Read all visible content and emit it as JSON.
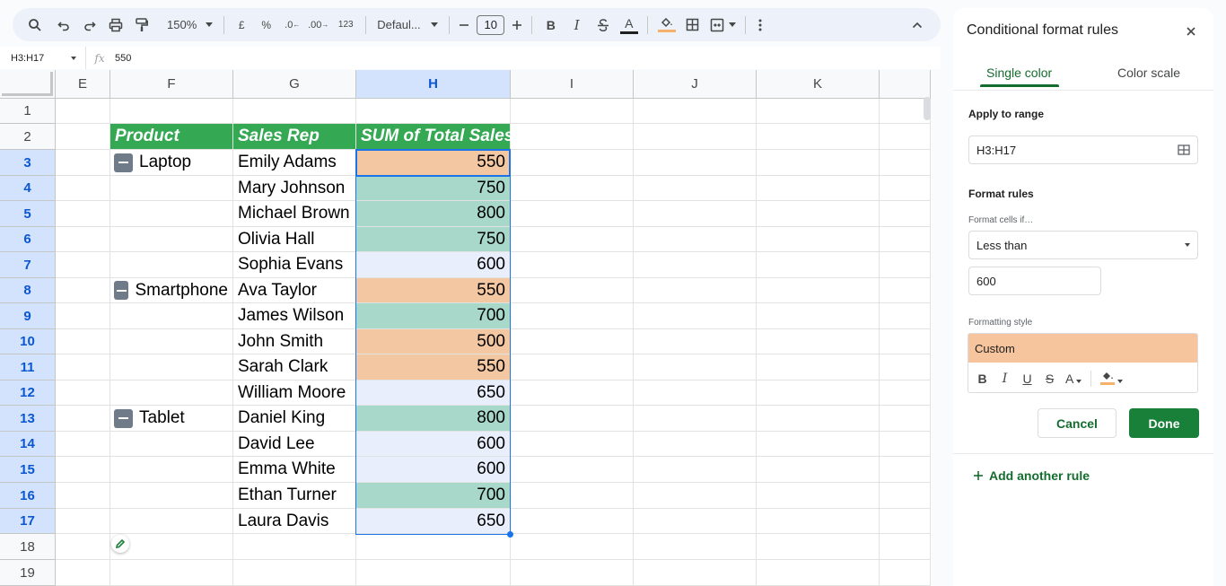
{
  "toolbar": {
    "zoom": "150%",
    "currency": "£",
    "percent": "%",
    "decrease_decimal": ".0",
    "increase_decimal": ".00",
    "number_format": "123",
    "font": "Defaul...",
    "font_size": "10",
    "bold": "B",
    "italic": "I",
    "text_color": "A",
    "text_color_bar": "#1f1f1f",
    "fill_color_bar": "#f6b26b"
  },
  "formula_bar": {
    "name_box": "H3:H17",
    "fx": "fx",
    "value": "550"
  },
  "grid": {
    "columns": [
      "E",
      "F",
      "G",
      "H",
      "I",
      "J",
      "K"
    ],
    "rows": [
      "1",
      "2",
      "3",
      "4",
      "5",
      "6",
      "7",
      "8",
      "9",
      "10",
      "11",
      "12",
      "13",
      "14",
      "15",
      "16",
      "17",
      "18",
      "19"
    ],
    "headers": {
      "product": "Product",
      "sales_rep": "Sales Rep",
      "sum": "SUM of Total Sales"
    },
    "groups": [
      "Laptop",
      "Smartphone",
      "Tablet"
    ],
    "data": [
      {
        "group": "Laptop",
        "rep": "Emily Adams",
        "value": "550",
        "color": "peach"
      },
      {
        "group": "",
        "rep": "Mary Johnson",
        "value": "750",
        "color": "teal"
      },
      {
        "group": "",
        "rep": "Michael Brown",
        "value": "800",
        "color": "teal"
      },
      {
        "group": "",
        "rep": "Olivia Hall",
        "value": "750",
        "color": "teal"
      },
      {
        "group": "",
        "rep": "Sophia Evans",
        "value": "600",
        "color": "lav"
      },
      {
        "group": "Smartphone",
        "rep": "Ava Taylor",
        "value": "550",
        "color": "peach"
      },
      {
        "group": "",
        "rep": "James Wilson",
        "value": "700",
        "color": "teal"
      },
      {
        "group": "",
        "rep": "John Smith",
        "value": "500",
        "color": "peach"
      },
      {
        "group": "",
        "rep": "Sarah Clark",
        "value": "550",
        "color": "peach"
      },
      {
        "group": "",
        "rep": "William Moore",
        "value": "650",
        "color": "lav"
      },
      {
        "group": "Tablet",
        "rep": "Daniel King",
        "value": "800",
        "color": "teal"
      },
      {
        "group": "",
        "rep": "David Lee",
        "value": "600",
        "color": "lav"
      },
      {
        "group": "",
        "rep": "Emma White",
        "value": "600",
        "color": "lav"
      },
      {
        "group": "",
        "rep": "Ethan Turner",
        "value": "700",
        "color": "teal"
      },
      {
        "group": "",
        "rep": "Laura Davis",
        "value": "650",
        "color": "lav"
      }
    ],
    "colors": {
      "header_green": "#34a853",
      "peach": "#f4c7a3",
      "teal": "#a8d8c9",
      "lavender": "#e8eefb",
      "selection": "#1a73e8"
    }
  },
  "panel": {
    "title": "Conditional format rules",
    "tabs": [
      "Single color",
      "Color scale"
    ],
    "apply_label": "Apply to range",
    "range": "H3:H17",
    "format_rules_label": "Format rules",
    "format_cells_if": "Format cells if…",
    "condition": "Less than",
    "condition_value": "600",
    "formatting_style_label": "Formatting style",
    "style_name": "Custom",
    "style_color": "#f6c59d",
    "style_tools": {
      "bold": "B",
      "italic": "I",
      "underline": "U",
      "strike": "S",
      "text_color": "A"
    },
    "cancel": "Cancel",
    "done": "Done",
    "add_rule": "Add another rule",
    "accent": "#146c2e"
  }
}
